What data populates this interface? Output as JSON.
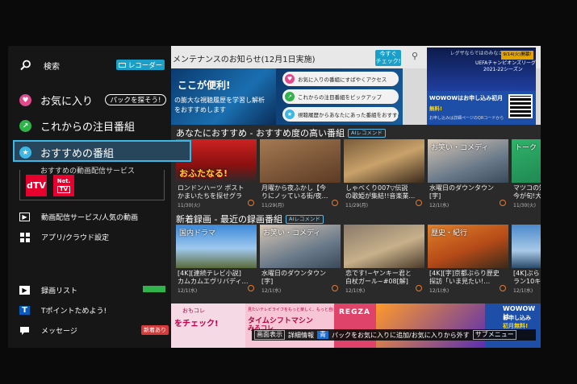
{
  "menu": {
    "search": "検索",
    "recorder": "レコーダー",
    "favorites": "お気に入り",
    "pack_search": "パックを探そう!",
    "upcoming": "これからの注目番組",
    "recommended": "おすすめの番組",
    "services_label": "おすすめの動画配信サービス",
    "service_dtv": "dTV",
    "service_net1": "Net.",
    "service_net2": "TV",
    "popular_videos": "動画配信サービス/人気の動画",
    "apps": "アプリ/クラウド設定",
    "recording_list": "録画リスト",
    "tpoint": "Tポイントためよう!",
    "message": "メッセージ",
    "message_badge": "新着あり"
  },
  "notice": {
    "text": "メンテナンスのお知らせ(12月1日実施)",
    "button_line1": "今すぐ",
    "button_line2": "チェック!"
  },
  "promo": {
    "headline": "ここが便利!",
    "sub1": "の膨大な視聴履歴を学習し解析",
    "sub2": "をおすすめします",
    "pill1": "お気に入りの番組にすばやくアクセス",
    "pill2": "これからの注目番組をピックアップ",
    "pill3": "視聴履歴からあなたにあった番組をおすすめ"
  },
  "uefa": {
    "top_text": "レグザならではのみなさまへ",
    "date": "9/14(火)開幕!",
    "title1": "UEFAチャンピオンズリーグ",
    "title2": "2021-22シーズン",
    "wowow1": "WOWOWはお申し込み初月",
    "wowow2": "無料!",
    "small": "お申し込みは詳細ページのQRコードから"
  },
  "sections": {
    "recommended_title": "あなたにおすすめ - おすすめ度の高い番組",
    "recent_title": "新着録画 - 最近の録画番組",
    "ai_tag": "AIレコメンド"
  },
  "recommended_cards": [
    {
      "line1": "ロンドンハーツ ボスト",
      "line2": "かまいたちを探せグラ",
      "date": "11/30(火)",
      "caption": "おふたなる!",
      "tag": ""
    },
    {
      "line1": "月曜から夜ふかし【今",
      "line2": "りにノッている街/夜…",
      "date": "11/29(月)",
      "caption": "",
      "tag": ""
    },
    {
      "line1": "しゃべくり007▽伝説",
      "line2": "の歌姫が集結!!音楽業…",
      "date": "11/29(月)",
      "caption": "",
      "tag": ""
    },
    {
      "line1": "水曜日のダウンタウン",
      "line2": "[字]",
      "date": "12/1(水)",
      "caption": "",
      "tag": "お笑い・コメディ"
    },
    {
      "line1": "マツコの知",
      "line2": "今が旬!大",
      "date": "11/30(火)",
      "caption": "",
      "tag": "トーク"
    }
  ],
  "recent_cards": [
    {
      "line1": "[4K][連続テレビ小説]",
      "line2": "カムカムエヴリバディ…",
      "date": "12/1(水)",
      "tag": "国内ドラマ"
    },
    {
      "line1": "水曜日のダウンタウン",
      "line2": "[字]",
      "date": "12/1(水)",
      "tag": "お笑い・コメディ"
    },
    {
      "line1": "恋です!~ヤンキー君と",
      "line2": "白杖ガール~#08[解]",
      "date": "12/1(水)",
      "tag": ""
    },
    {
      "line1": "[4K][字]京都ぶらり歴史",
      "line2": "探訪「いま見たい!…",
      "date": "12/1(水)",
      "tag": "歴史・紀行"
    },
    {
      "line1": "[4K]ぶら",
      "line2": "ラン10キ",
      "date": "12/1(水)",
      "tag": ""
    }
  ],
  "bottom_ads": {
    "ad1_line1": "おもコレ",
    "ad1_line2": "をチェック!",
    "ad2_line1": "見たいテレビライフをもっと楽しく、もっと自由に",
    "ad2_line2": "タイムシフトマシン",
    "ad2_line3": "みるコレ",
    "ad3": "REGZA",
    "ad5_line1": "WOWOWは",
    "ad5_line2": "お申し込み",
    "ad5_line3": "初月無料!"
  },
  "hint": {
    "screen": "画面表示",
    "detail": "詳細情報",
    "blue": "青",
    "pack_text": "パックをお気に入りに追加/お気に入りから外す",
    "submenu": "サブメニュー"
  },
  "colors": {
    "accent": "#1aa0c8",
    "selection": "#3db7e4"
  }
}
